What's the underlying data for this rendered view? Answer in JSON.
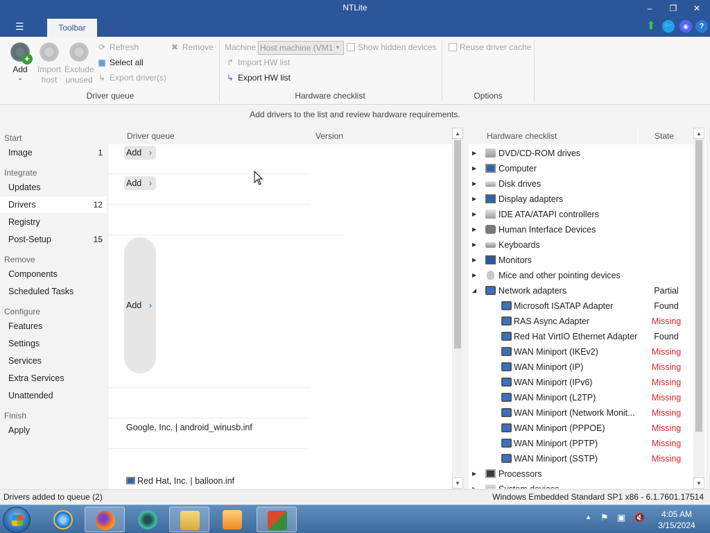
{
  "window": {
    "title": "NTLite",
    "minimize": "–",
    "maximize": "❐",
    "close": "✕"
  },
  "menu_icon": "☰",
  "ribbon_tab": "Toolbar",
  "title_icons": [
    "up-arrow-icon",
    "twitter-icon",
    "discord-icon",
    "help-icon"
  ],
  "help_glyph": "?",
  "ribbon": {
    "add": {
      "label": "Add",
      "arrow": "⌄"
    },
    "import_host": {
      "line1": "Import",
      "line2": "host"
    },
    "exclude_unused": {
      "line1": "Exclude",
      "line2": "unused"
    },
    "refresh": "Refresh",
    "remove": "Remove",
    "select_all": "Select all",
    "export_drivers": "Export driver(s)",
    "driver_queue_group": "Driver queue",
    "machine_label": "Machine",
    "machine_value": "Host machine (VM1",
    "show_hidden": "Show hidden devices",
    "import_hw": "Import HW list",
    "export_hw": "Export HW list",
    "hardware_group": "Hardware checklist",
    "reuse_cache": "Reuse driver cache",
    "options_group": "Options"
  },
  "info_text": "Add drivers to the list and review hardware requirements.",
  "nav": {
    "start": "Start",
    "image": {
      "label": "Image",
      "count": "1"
    },
    "integrate": "Integrate",
    "updates": "Updates",
    "drivers": {
      "label": "Drivers",
      "count": "12"
    },
    "registry": "Registry",
    "postsetup": {
      "label": "Post-Setup",
      "count": "15"
    },
    "remove": "Remove",
    "components": "Components",
    "scheduled": "Scheduled Tasks",
    "configure": "Configure",
    "features": "Features",
    "settings": "Settings",
    "services": "Services",
    "extra_services": "Extra Services",
    "unattended": "Unattended",
    "finish": "Finish",
    "apply": "Apply"
  },
  "driver_queue": {
    "col_name": "Driver queue",
    "col_version": "Version",
    "add_label": "Add",
    "chevron": "›",
    "row_google": "Google, Inc.  |  android_winusb.inf",
    "row_redhat": "Red Hat, Inc.  |  balloon.inf"
  },
  "hardware": {
    "col_name": "Hardware checklist",
    "col_state": "State",
    "categories": [
      "DVD/CD-ROM drives",
      "Computer",
      "Disk drives",
      "Display adapters",
      "IDE ATA/ATAPI controllers",
      "Human Interface Devices",
      "Keyboards",
      "Monitors",
      "Mice and other pointing devices"
    ],
    "network": {
      "label": "Network adapters",
      "state": "Partial"
    },
    "adapters": [
      {
        "name": "Microsoft ISATAP Adapter",
        "state": "Found"
      },
      {
        "name": "RAS Async Adapter",
        "state": "Missing"
      },
      {
        "name": "Red Hat VirtIO Ethernet Adapter",
        "state": "Found"
      },
      {
        "name": "WAN Miniport (IKEv2)",
        "state": "Missing"
      },
      {
        "name": "WAN Miniport (IP)",
        "state": "Missing"
      },
      {
        "name": "WAN Miniport (IPv6)",
        "state": "Missing"
      },
      {
        "name": "WAN Miniport (L2TP)",
        "state": "Missing"
      },
      {
        "name": "WAN Miniport (Network Monit...",
        "state": "Missing"
      },
      {
        "name": "WAN Miniport (PPPOE)",
        "state": "Missing"
      },
      {
        "name": "WAN Miniport (PPTP)",
        "state": "Missing"
      },
      {
        "name": "WAN Miniport (SSTP)",
        "state": "Missing"
      }
    ],
    "processors": "Processors",
    "system_devices": "System devices"
  },
  "status": {
    "left": "Drivers added to queue (2)",
    "right": "Windows Embedded Standard SP1 x86 - 6.1.7601.17514"
  },
  "taskbar": {
    "time": "4:05 AM",
    "date": "3/15/2024",
    "apps": [
      "ie-icon",
      "firefox-icon",
      "app-icon",
      "explorer-icon",
      "media-player-icon",
      "ntlite-icon"
    ]
  },
  "colors": {
    "accent": "#2b579a",
    "missing": "#e0242b"
  }
}
